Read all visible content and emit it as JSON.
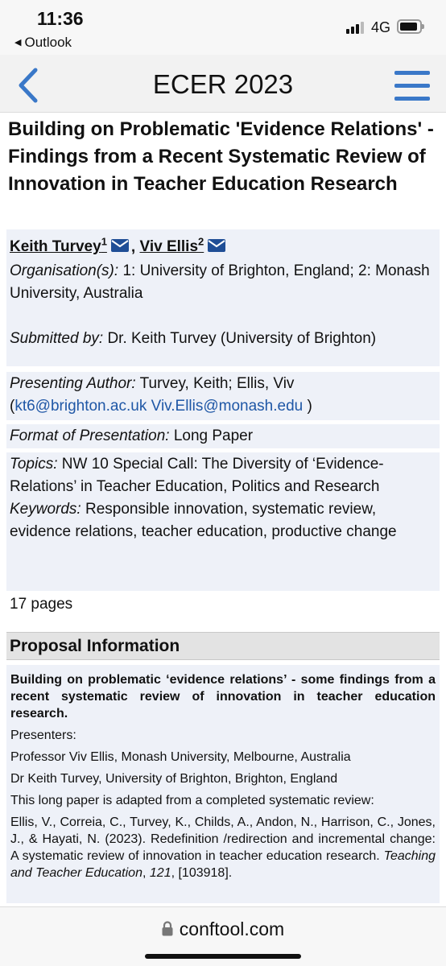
{
  "status_bar": {
    "time": "11:36",
    "back_app": "Outlook",
    "network": "4G"
  },
  "header": {
    "title": "ECER 2023",
    "back_icon": "chevron-left-icon",
    "menu_icon": "hamburger-menu-icon",
    "accent_color": "#3a78c8"
  },
  "paper": {
    "title": "Building on Problematic 'Evidence Relations' - Findings from a Recent Systematic Review of Innovation in Teacher Education Research",
    "authors": [
      {
        "name": "Keith Turvey",
        "sup": "1"
      },
      {
        "name": "Viv Ellis",
        "sup": "2"
      }
    ],
    "author_separator": ",",
    "organisations_label": "Organisation(s):",
    "organisations_value": "1: University of Brighton, England; 2: Monash University, Australia",
    "submitted_label": "Submitted by:",
    "submitted_value": "Dr. Keith Turvey (University of Brighton)",
    "presenting_label": "Presenting Author:",
    "presenting_value": "Turvey, Keith; Ellis, Viv",
    "email_1": "kt6@brighton.ac.uk",
    "email_2": "Viv.Ellis@monash.edu",
    "open_paren": "(",
    "close_paren": ")",
    "format_label": "Format of Presentation:",
    "format_value": "Long Paper",
    "topics_label": "Topics:",
    "topics_value": "NW 10 Special Call: The Diversity of ‘Evidence-Relations’ in Teacher Education, Politics and Research",
    "keywords_label": "Keywords:",
    "keywords_value": "Responsible innovation, systematic review, evidence relations, teacher education, productive change",
    "pages": "17 pages"
  },
  "proposal": {
    "heading": "Proposal Information",
    "title": "Building on problematic ‘evidence relations’ - some findings from a recent systematic review of innovation in teacher education research.",
    "presenters_label": "Presenters:",
    "presenter_1": "Professor Viv Ellis, Monash University, Melbourne, Australia",
    "presenter_2": "Dr Keith Turvey, University of Brighton, Brighton, England",
    "intro": "This long paper is adapted from a completed systematic review:",
    "citation_main": "Ellis, V., Correia, C., Turvey, K., Childs, A., Andon, N., Harrison, C., Jones, J., & Hayati, N. (2023). Redefinition /redirection and incremental change: A systematic review of innovation in teacher education research.",
    "citation_journal": "Teaching and Teacher Education",
    "citation_sep": ",",
    "citation_volume": "121",
    "citation_tail": ", [103918]."
  },
  "url_bar": {
    "url": "conftool.com",
    "lock_icon": "lock-icon"
  }
}
